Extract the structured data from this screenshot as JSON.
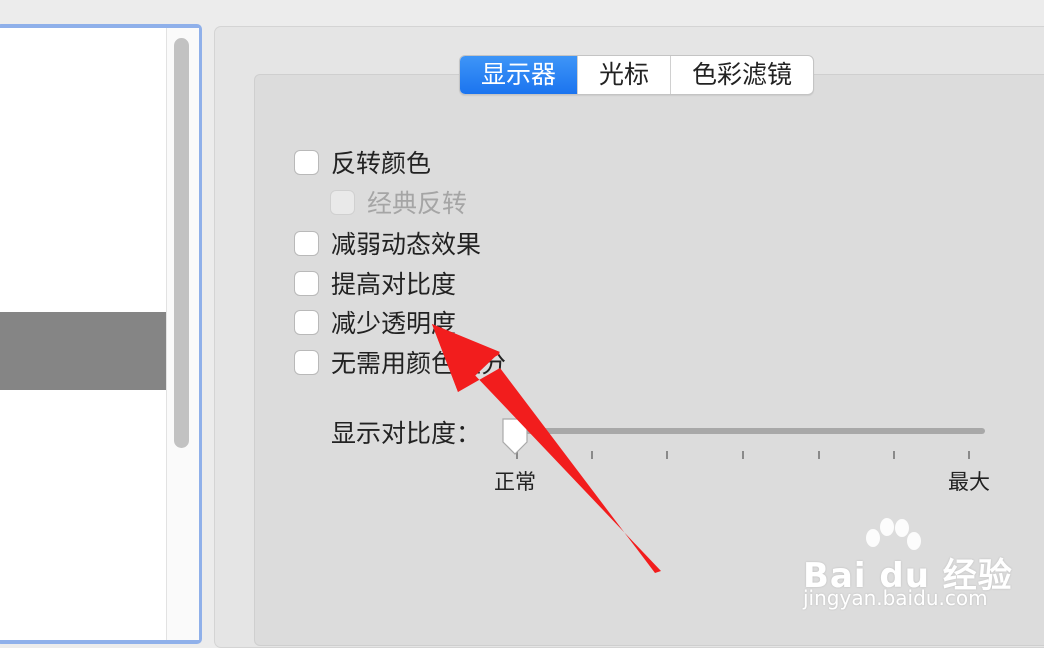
{
  "tabs": [
    "显示器",
    "光标",
    "色彩滤镜"
  ],
  "active_tab_index": 0,
  "options": [
    {
      "label": "反转颜色",
      "checked": false,
      "enabled": true
    },
    {
      "label": "经典反转",
      "checked": false,
      "enabled": false
    },
    {
      "label": "减弱动态效果",
      "checked": false,
      "enabled": true
    },
    {
      "label": "提高对比度",
      "checked": false,
      "enabled": true
    },
    {
      "label": "减少透明度",
      "checked": false,
      "enabled": true
    },
    {
      "label": "无需用颜色区分",
      "checked": false,
      "enabled": true
    }
  ],
  "contrast": {
    "label": "显示对比度：",
    "min_label": "正常",
    "max_label": "最大",
    "value": 0
  },
  "watermark": {
    "logo": "Bai du 经验",
    "url": "jingyan.baidu.com"
  },
  "colors": {
    "accent": "#1b74ef",
    "arrow": "#f21d1d",
    "selection": "#858585"
  }
}
